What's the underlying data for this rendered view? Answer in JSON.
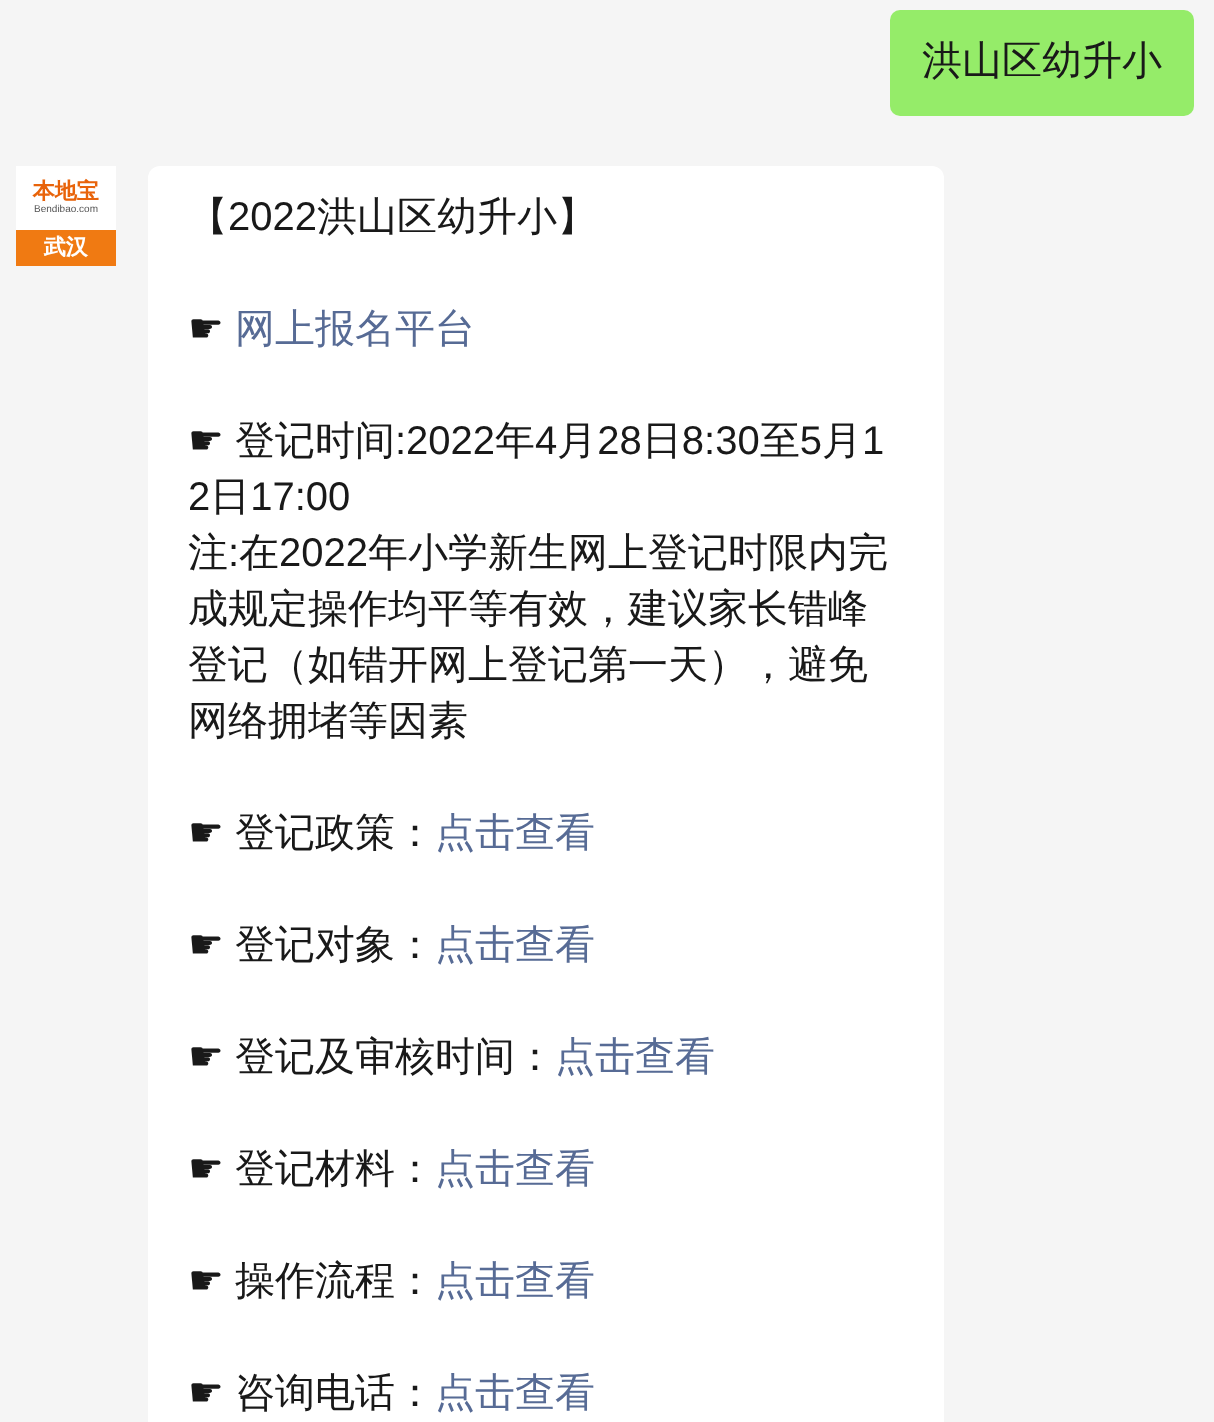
{
  "sent_message": {
    "text": "洪山区幼升小"
  },
  "sender_avatar": {
    "brand": "本地宝",
    "site": "Bendibao.com",
    "city": "武汉"
  },
  "received_message": {
    "title": "【2022洪山区幼升小】",
    "items": [
      {
        "kind": "link",
        "bullet": "☛",
        "link": "网上报名平台"
      },
      {
        "kind": "text",
        "bullet": "☛",
        "label": "登记时间:2022年4月28日8:30至5月12日17:00",
        "note": "注:在2022年小学新生网上登记时限内完成规定操作均平等有效，建议家长错峰登记（如错开网上登记第一天），避免网络拥堵等因素"
      },
      {
        "kind": "label_link",
        "bullet": "☛",
        "label": "登记政策：",
        "link": "点击查看"
      },
      {
        "kind": "label_link",
        "bullet": "☛",
        "label": "登记对象：",
        "link": "点击查看"
      },
      {
        "kind": "label_link",
        "bullet": "☛",
        "label": "登记及审核时间：",
        "link": "点击查看"
      },
      {
        "kind": "label_link",
        "bullet": "☛",
        "label": "登记材料：",
        "link": "点击查看"
      },
      {
        "kind": "label_link",
        "bullet": "☛",
        "label": "操作流程：",
        "link": "点击查看"
      },
      {
        "kind": "label_link",
        "bullet": "☛",
        "label": "咨询电话：",
        "link": "点击查看"
      }
    ]
  }
}
